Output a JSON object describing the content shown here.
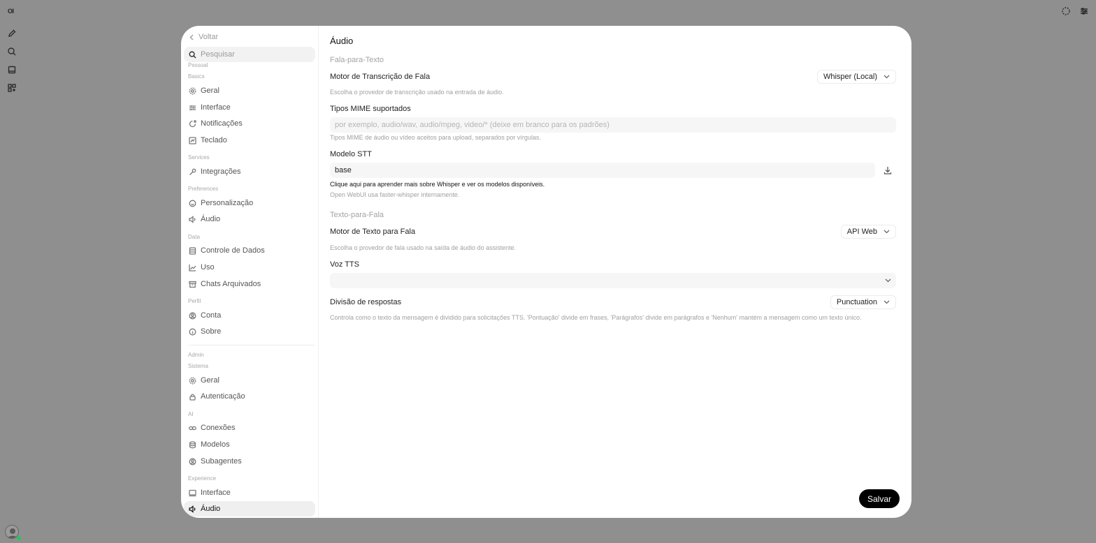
{
  "app": {
    "logo": "OI"
  },
  "sidebar": {
    "back_label": "Voltar",
    "search_placeholder": "Pesquisar",
    "personal_label": "Pessoal",
    "groups": {
      "basics": "Basics",
      "services": "Services",
      "preferences": "Preferences",
      "data": "Data",
      "profile": "Perfil",
      "admin": "Admin",
      "system": "Sistema",
      "ai": "AI",
      "experience": "Experience"
    },
    "items": {
      "geral": "Geral",
      "interface": "Interface",
      "notificacoes": "Notificações",
      "teclado": "Teclado",
      "integracoes": "Integrações",
      "personalizacao": "Personalização",
      "audio": "Áudio",
      "controle_dados": "Controle de Dados",
      "uso": "Uso",
      "chats_arquivados": "Chats Arquivados",
      "conta": "Conta",
      "sobre": "Sobre",
      "admin_geral": "Geral",
      "autenticacao": "Autenticação",
      "conexoes": "Conexões",
      "modelos": "Modelos",
      "subagentes": "Subagentes",
      "exp_interface": "Interface",
      "exp_audio": "Áudio"
    },
    "active_item": "exp_audio"
  },
  "main": {
    "title": "Áudio",
    "stt": {
      "heading": "Fala-para-Texto",
      "engine_label": "Motor de Transcrição de Fala",
      "engine_value": "Whisper (Local)",
      "engine_hint": "Escolha o provedor de transcrição usado na entrada de áudio.",
      "mime_label": "Tipos MIME suportados",
      "mime_placeholder": "por exemplo, audio/wav, audio/mpeg, video/* (deixe em branco para os padrões)",
      "mime_hint": "Tipos MIME de áudio ou vídeo aceitos para upload, separados por vírgulas.",
      "model_label": "Modelo STT",
      "model_value": "base",
      "model_link": "Clique aqui para aprender mais sobre Whisper e ver os modelos disponíveis.",
      "model_hint": "Open WebUI usa faster-whisper internamente."
    },
    "tts": {
      "heading": "Texto-para-Fala",
      "engine_label": "Motor de Texto para Fala",
      "engine_value": "API Web",
      "engine_hint": "Escolha o provedor de fala usado na saída de áudio do assistente.",
      "voice_label": "Voz TTS",
      "voice_value": "",
      "split_label": "Divisão de respostas",
      "split_value": "Punctuation",
      "split_hint": "Controla como o texto da mensagem é dividido para solicitações TTS. 'Pontuação' divide em frases, 'Parágrafos' divide em parágrafos e 'Nenhum' mantém a mensagem como um texto único."
    },
    "save_label": "Salvar"
  }
}
